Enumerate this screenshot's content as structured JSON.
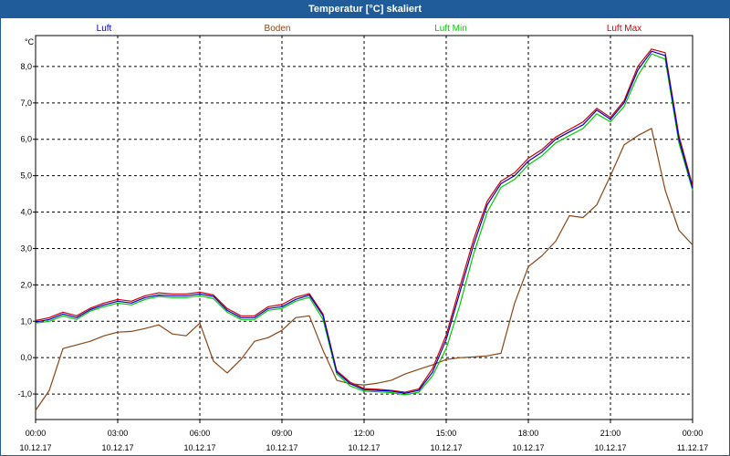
{
  "window": {
    "title": "Temperatur [°C] skaliert"
  },
  "chart_data": {
    "type": "line",
    "ylabel": "°C",
    "ylim": [
      -1.7,
      8.85
    ],
    "xlim": [
      "10.12.17 00:00",
      "11.12.17 00:00"
    ],
    "grid": true,
    "legend_position": "top",
    "y_ticks": [
      "-1,0",
      "0,0",
      "1,0",
      "2,0",
      "3,0",
      "4,0",
      "5,0",
      "6,0",
      "7,0",
      "8,0"
    ],
    "x_ticks": [
      {
        "time": "00:00",
        "date": "10.12.17"
      },
      {
        "time": "03:00",
        "date": "10.12.17"
      },
      {
        "time": "06:00",
        "date": "10.12.17"
      },
      {
        "time": "09:00",
        "date": "10.12.17"
      },
      {
        "time": "12:00",
        "date": "10.12.17"
      },
      {
        "time": "15:00",
        "date": "10.12.17"
      },
      {
        "time": "18:00",
        "date": "10.12.17"
      },
      {
        "time": "21:00",
        "date": "10.12.17"
      },
      {
        "time": "00:00",
        "date": "11.12.17"
      }
    ],
    "x_hours": [
      0,
      0.5,
      1,
      1.5,
      2,
      2.5,
      3,
      3.5,
      4,
      4.5,
      5,
      5.5,
      6,
      6.5,
      7,
      7.5,
      8,
      8.5,
      9,
      9.5,
      10,
      10.5,
      11,
      11.5,
      12,
      12.5,
      13,
      13.5,
      14,
      14.5,
      15,
      15.5,
      16,
      16.5,
      17,
      17.5,
      18,
      18.5,
      19,
      19.5,
      20,
      20.5,
      21,
      21.5,
      22,
      22.5,
      23,
      23.5,
      24
    ],
    "series": [
      {
        "name": "Luft",
        "color": "#0000cc",
        "values": [
          0.98,
          1.05,
          1.2,
          1.1,
          1.32,
          1.45,
          1.55,
          1.5,
          1.65,
          1.72,
          1.7,
          1.7,
          1.75,
          1.68,
          1.3,
          1.1,
          1.1,
          1.35,
          1.4,
          1.6,
          1.72,
          1.15,
          -0.4,
          -0.72,
          -0.88,
          -0.9,
          -0.92,
          -0.98,
          -0.9,
          -0.4,
          0.5,
          1.8,
          3.1,
          4.2,
          4.78,
          5.0,
          5.4,
          5.65,
          6.0,
          6.2,
          6.4,
          6.8,
          6.55,
          7.0,
          7.9,
          8.42,
          8.3,
          6.0,
          4.65
        ]
      },
      {
        "name": "Boden",
        "color": "#8b4513",
        "values": [
          -1.45,
          -0.9,
          0.25,
          0.35,
          0.45,
          0.6,
          0.7,
          0.72,
          0.8,
          0.9,
          0.65,
          0.6,
          0.95,
          -0.1,
          -0.42,
          -0.05,
          0.45,
          0.55,
          0.75,
          1.1,
          1.15,
          0.2,
          -0.62,
          -0.72,
          -0.75,
          -0.7,
          -0.62,
          -0.45,
          -0.32,
          -0.2,
          -0.05,
          0.0,
          0.02,
          0.05,
          0.12,
          1.5,
          2.5,
          2.8,
          3.2,
          3.9,
          3.85,
          4.2,
          5.0,
          5.85,
          6.1,
          6.3,
          4.6,
          3.5,
          3.1
        ]
      },
      {
        "name": "Luft Min",
        "color": "#00cc00",
        "values": [
          0.95,
          1.0,
          1.15,
          1.05,
          1.28,
          1.4,
          1.5,
          1.45,
          1.6,
          1.68,
          1.65,
          1.65,
          1.7,
          1.62,
          1.25,
          1.05,
          1.05,
          1.3,
          1.35,
          1.55,
          1.66,
          1.05,
          -0.45,
          -0.78,
          -0.92,
          -0.94,
          -0.96,
          -1.02,
          -0.95,
          -0.5,
          0.25,
          1.45,
          2.85,
          4.0,
          4.68,
          4.9,
          5.3,
          5.55,
          5.9,
          6.1,
          6.3,
          6.7,
          6.48,
          6.9,
          7.75,
          8.35,
          8.2,
          5.9,
          4.6
        ]
      },
      {
        "name": "Luft Max",
        "color": "#cc0000",
        "values": [
          1.02,
          1.1,
          1.25,
          1.15,
          1.36,
          1.5,
          1.6,
          1.55,
          1.7,
          1.78,
          1.75,
          1.75,
          1.8,
          1.72,
          1.35,
          1.15,
          1.15,
          1.4,
          1.46,
          1.66,
          1.76,
          1.2,
          -0.36,
          -0.68,
          -0.85,
          -0.87,
          -0.9,
          -0.95,
          -0.86,
          -0.3,
          0.62,
          1.95,
          3.25,
          4.3,
          4.85,
          5.08,
          5.48,
          5.72,
          6.06,
          6.27,
          6.48,
          6.85,
          6.6,
          7.06,
          8.0,
          8.48,
          8.38,
          6.1,
          4.72
        ]
      }
    ]
  }
}
